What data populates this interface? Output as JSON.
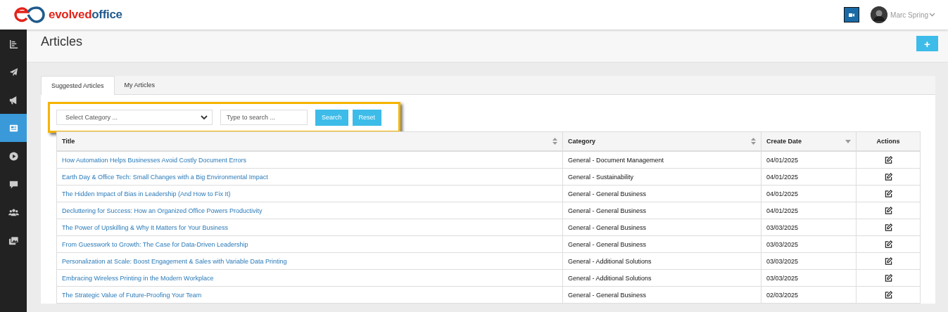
{
  "header": {
    "logo": {
      "first": "evolved",
      "second": "office"
    },
    "user": {
      "name": "Marc Spring"
    }
  },
  "sidebar": {
    "items": [
      {
        "selected": false
      },
      {
        "selected": false
      },
      {
        "selected": false
      },
      {
        "selected": true
      },
      {
        "selected": false
      },
      {
        "selected": false
      },
      {
        "selected": false
      },
      {
        "selected": false
      }
    ]
  },
  "page": {
    "title": "Articles",
    "add_button": "+"
  },
  "tabs": [
    {
      "label": "Suggested Articles",
      "selected": true
    },
    {
      "label": "My Articles",
      "selected": false
    }
  ],
  "filters": {
    "category": {
      "placeholder": "Select Category ..."
    },
    "search": {
      "placeholder": "Type to search ..."
    },
    "buttons": [
      "Search",
      "Reset"
    ]
  },
  "table": {
    "columns": [
      {
        "label": "Title",
        "kind": "sortable"
      },
      {
        "label": "Category",
        "kind": "sortable"
      },
      {
        "label": "Create Date",
        "kind": "sorted"
      },
      {
        "label": "Actions",
        "kind": "plain"
      }
    ],
    "rows": [
      {
        "title": "How Automation Helps Businesses Avoid Costly Document Errors",
        "category": "General - Document Management",
        "date": "04/01/2025"
      },
      {
        "title": "Earth Day & Office Tech: Small Changes with a Big Environmental Impact",
        "category": "General - Sustainability",
        "date": "04/01/2025"
      },
      {
        "title": "The Hidden Impact of Bias in Leadership (And How to Fix It)",
        "category": "General - General Business",
        "date": "04/01/2025"
      },
      {
        "title": "Decluttering for Success: How an Organized Office Powers Productivity",
        "category": "General - General Business",
        "date": "04/01/2025"
      },
      {
        "title": "The Power of Upskilling & Why It Matters for Your Business",
        "category": "General - General Business",
        "date": "03/03/2025"
      },
      {
        "title": "From Guesswork to Growth: The Case for Data-Driven Leadership",
        "category": "General - General Business",
        "date": "03/03/2025"
      },
      {
        "title": "Personalization at Scale: Boost Engagement & Sales with Variable Data Printing",
        "category": "General - Additional Solutions",
        "date": "03/03/2025"
      },
      {
        "title": "Embracing Wireless Printing in the Modern Workplace",
        "category": "General - Additional Solutions",
        "date": "03/03/2025"
      },
      {
        "title": "The Strategic Value of Future-Proofing Your Team",
        "category": "General - General Business",
        "date": "02/03/2025"
      }
    ]
  }
}
